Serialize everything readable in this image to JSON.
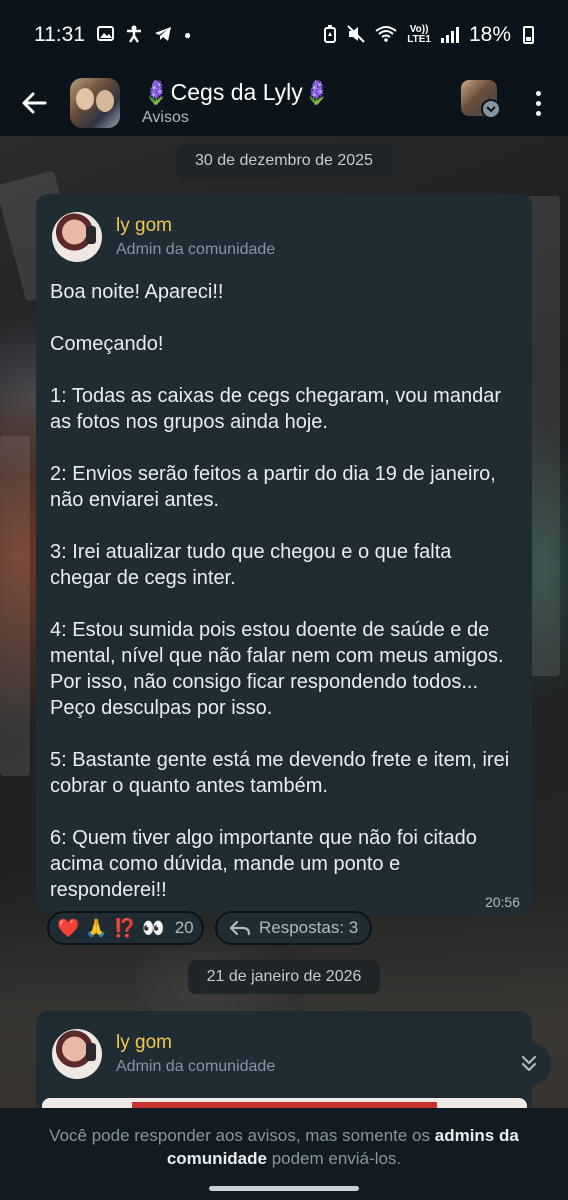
{
  "status_bar": {
    "time": "11:31",
    "battery": "18%",
    "network": "LTE1",
    "left_icons": [
      "image-icon",
      "accessibility-icon",
      "telegram-icon",
      "dot-icon"
    ],
    "right_icons": [
      "battery-saver-icon",
      "mute-icon",
      "wifi-icon",
      "volte-icon",
      "signal-icon",
      "battery-icon"
    ]
  },
  "header": {
    "title": "🪻Cegs da Lyly🪻",
    "subtitle": "Avisos"
  },
  "messages": [
    {
      "date_label": "30 de dezembro de 2025",
      "author": "ly gom",
      "role": "Admin da comunidade",
      "paragraphs": [
        "Boa noite! Apareci!!",
        "Começando!",
        "1: Todas as caixas de cegs chegaram, vou mandar as fotos nos grupos ainda hoje.",
        "2: Envios serão feitos a partir do dia 19 de janeiro, não enviarei antes.",
        "3: Irei atualizar tudo que chegou e o que falta chegar de cegs inter.",
        "4: Estou sumida pois estou doente de saúde e de mental, nível que não falar nem com meus amigos. Por isso, não consigo ficar respondendo todos... Peço desculpas por isso.",
        "5: Bastante gente está me devendo frete e item, irei cobrar o quanto antes também.",
        "6: Quem tiver algo importante que não foi citado acima como dúvida, mande um ponto e responderei!!"
      ],
      "time": "20:56",
      "reactions": [
        "❤️",
        "🙏",
        "⁉️",
        "👀"
      ],
      "reaction_count": "20",
      "replies_label": "Respostas: 3"
    },
    {
      "date_label": "21 de janeiro de 2026",
      "author": "ly gom",
      "role": "Admin da comunidade"
    }
  ],
  "footer": {
    "text_before": "Você pode responder aos avisos, mas somente os ",
    "text_bold": "admins da comunidade",
    "text_after": " podem enviá-los."
  }
}
